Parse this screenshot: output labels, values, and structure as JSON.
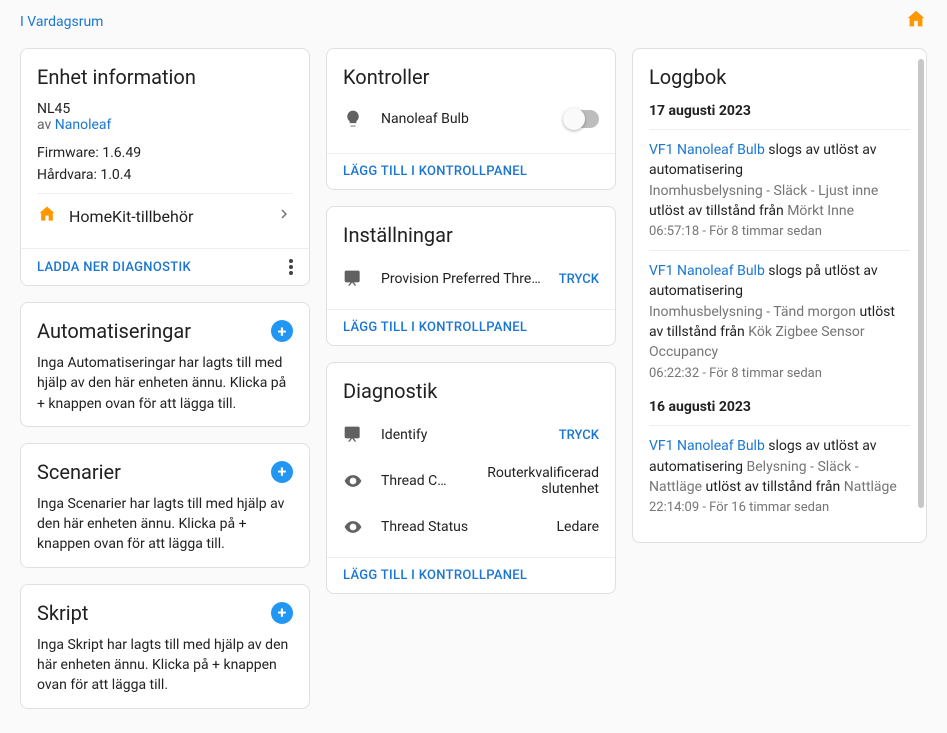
{
  "breadcrumb": "I Vardagsrum",
  "device_info": {
    "title": "Enhet information",
    "model": "NL45",
    "by_prefix": "av ",
    "manufacturer": "Nanoleaf",
    "firmware_label": "Firmware: ",
    "firmware_value": "1.6.49",
    "hardware_label": "Hårdvara: ",
    "hardware_value": "1.0.4",
    "integration": "HomeKit-tillbehör",
    "download_diag": "LADDA NER DIAGNOSTIK"
  },
  "automations": {
    "title": "Automatiseringar",
    "empty": "Inga Automatiseringar har lagts till med hjälp av den här enheten ännu. Klicka på + knappen ovan för att lägga till."
  },
  "scenes": {
    "title": "Scenarier",
    "empty": "Inga Scenarier har lagts till med hjälp av den här enheten ännu. Klicka på + knappen ovan för att lägga till."
  },
  "scripts": {
    "title": "Skript",
    "empty": "Inga Skript har lagts till med hjälp av den här enheten ännu. Klicka på + knappen ovan för att lägga till."
  },
  "controls": {
    "title": "Kontroller",
    "entity": "Nanoleaf Bulb",
    "add": "LÄGG TILL I KONTROLLPANEL"
  },
  "settings": {
    "title": "Inställningar",
    "row_label": "Provision Preferred Threa…",
    "action": "TRYCK",
    "add": "LÄGG TILL I KONTROLLPANEL"
  },
  "diagnostics": {
    "title": "Diagnostik",
    "rows": [
      {
        "label": "Identify",
        "value": "",
        "action": "TRYCK",
        "icon": "diag"
      },
      {
        "label": "Thread Ca…",
        "value": "Routerkvalificerad slutenhet",
        "action": "",
        "icon": "eye"
      },
      {
        "label": "Thread Status",
        "value": "Ledare",
        "action": "",
        "icon": "eye"
      }
    ],
    "add": "LÄGG TILL I KONTROLLPANEL"
  },
  "logbook": {
    "title": "Loggbok",
    "groups": [
      {
        "date": "17 augusti 2023",
        "entries": [
          {
            "subject": "VF1 Nanoleaf Bulb",
            "text1": " slogs av utlöst av automatisering ",
            "link2": "Inomhusbelysning - Släck - Ljust inne",
            "text2": " utlöst av tillstånd från ",
            "link3": "Mörkt Inne",
            "time": "06:57:18 - För 8 timmar sedan"
          },
          {
            "subject": "VF1 Nanoleaf Bulb",
            "text1": " slogs på utlöst av automatisering ",
            "link2": "Inomhusbelysning - Tänd morgon",
            "text2": " utlöst av tillstånd från ",
            "link3": "Kök Zigbee Sensor Occupancy",
            "time": "06:22:32 - För 8 timmar sedan"
          }
        ]
      },
      {
        "date": "16 augusti 2023",
        "entries": [
          {
            "subject": "VF1 Nanoleaf Bulb",
            "text1": " slogs av utlöst av automatisering ",
            "link2": "Belysning - Släck - Nattläge",
            "text2": " utlöst av tillstånd från ",
            "link3": "Nattläge",
            "time": "22:14:09 - För 16 timmar sedan"
          }
        ]
      }
    ]
  }
}
